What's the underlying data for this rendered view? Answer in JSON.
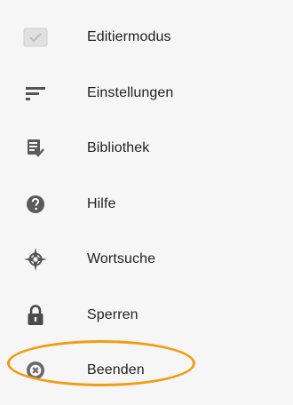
{
  "menu": {
    "items": [
      {
        "id": "edit",
        "label": "Editiermodus",
        "icon": "checkbox-icon"
      },
      {
        "id": "settings",
        "label": "Einstellungen",
        "icon": "settings-bars-icon"
      },
      {
        "id": "library",
        "label": "Bibliothek",
        "icon": "document-check-icon"
      },
      {
        "id": "help",
        "label": "Hilfe",
        "icon": "help-icon"
      },
      {
        "id": "wordsearch",
        "label": "Wortsuche",
        "icon": "compass-icon"
      },
      {
        "id": "lock",
        "label": "Sperren",
        "icon": "lock-icon"
      },
      {
        "id": "exit",
        "label": "Beenden",
        "icon": "close-circle-icon"
      }
    ]
  },
  "colors": {
    "background": "#f6f6f6",
    "text": "#222222",
    "icon": "#555555",
    "highlight": "#f39c12"
  }
}
